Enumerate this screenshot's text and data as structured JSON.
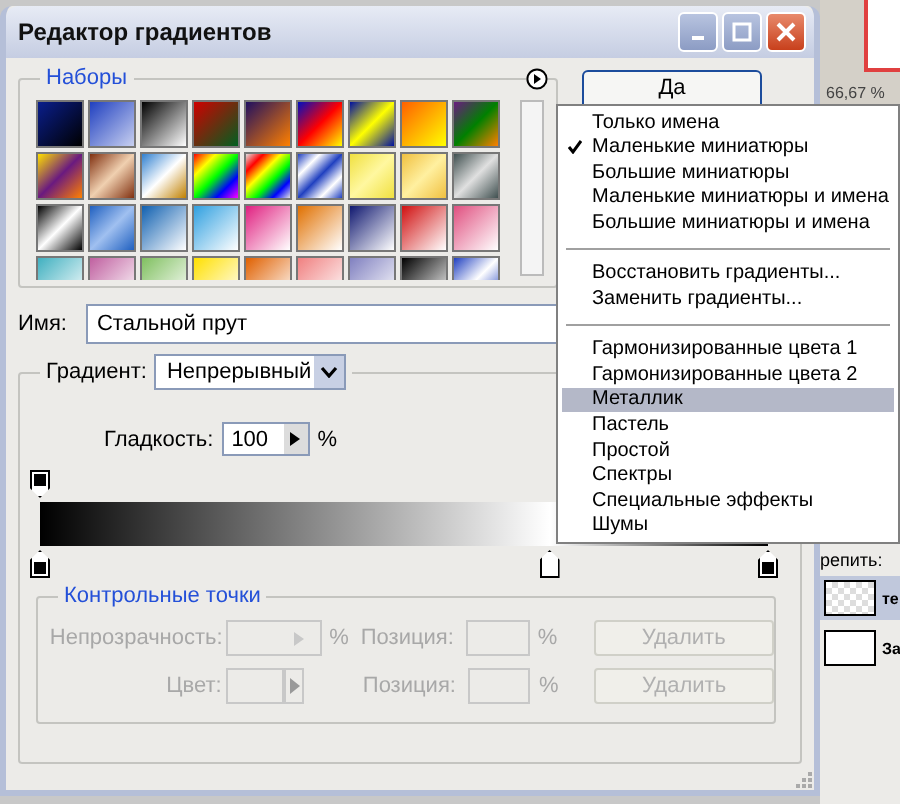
{
  "window": {
    "title": "Редактор градиентов"
  },
  "presets": {
    "legend": "Наборы"
  },
  "ok_button": {
    "label": "Да"
  },
  "name": {
    "label": "Имя:",
    "value": "Стальной прут"
  },
  "gradient": {
    "type_label": "Градиент:",
    "type_value": "Непрерывный",
    "smoothness_label": "Гладкость:",
    "smoothness_value": "100",
    "smoothness_unit": "%",
    "opacity_stops": [
      {
        "level": 0,
        "color": "#000000"
      }
    ],
    "color_stops": [
      {
        "level": 0,
        "color": "#000000"
      },
      {
        "level": 0.7,
        "color": "#ffffff"
      },
      {
        "level": 1,
        "color": "#000000"
      }
    ]
  },
  "stops_panel": {
    "legend": "Контрольные точки",
    "disabled": true,
    "rows": [
      {
        "kind": "opacity",
        "label": "Непрозрачность:",
        "unit": "%",
        "position_label": "Позиция:",
        "position_unit": "%",
        "delete": "Удалить"
      },
      {
        "kind": "color",
        "label": "Цвет:",
        "position_label": "Позиция:",
        "position_unit": "%",
        "delete": "Удалить"
      }
    ]
  },
  "menu": {
    "groups": [
      {
        "items": [
          {
            "label": "Только имена",
            "checked": false,
            "selected": false
          },
          {
            "label": "Маленькие миниатюры",
            "checked": true,
            "selected": false
          },
          {
            "label": "Большие миниатюры",
            "checked": false,
            "selected": false
          },
          {
            "label": "Маленькие миниатюры и имена",
            "checked": false,
            "selected": false
          },
          {
            "label": "Большие миниатюры и имена",
            "checked": false,
            "selected": false
          }
        ]
      },
      {
        "items": [
          {
            "label": "Восстановить градиенты...",
            "selected": false
          },
          {
            "label": "Заменить градиенты...",
            "selected": false
          }
        ]
      },
      {
        "items": [
          {
            "label": "Гармонизированные цвета 1",
            "selected": false
          },
          {
            "label": "Гармонизированные цвета 2",
            "selected": false
          },
          {
            "label": "Металлик",
            "selected": true
          },
          {
            "label": "Пастель",
            "selected": false
          },
          {
            "label": "Простой",
            "selected": false
          },
          {
            "label": "Спектры",
            "selected": false
          },
          {
            "label": "Специальные эффекты",
            "selected": false
          },
          {
            "label": "Шумы",
            "selected": false
          }
        ]
      }
    ]
  },
  "background_app": {
    "zoom": "66,67 %",
    "lock_label": "репить:",
    "layers": [
      {
        "name": "те",
        "kind": "transparent"
      },
      {
        "name": "За",
        "kind": "white"
      }
    ]
  }
}
